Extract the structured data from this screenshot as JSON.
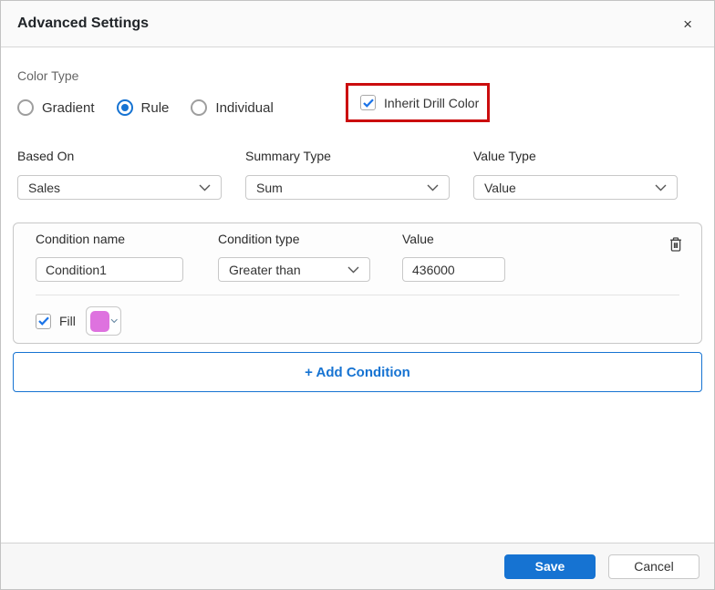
{
  "dialog": {
    "title": "Advanced Settings"
  },
  "icons": {
    "close": "×",
    "check": "✓",
    "chevron_down": "⌄",
    "trash": "trash-can",
    "color_swatch": "fill-color-swatch"
  },
  "color_type": {
    "label": "Color Type",
    "options": [
      {
        "label": "Gradient",
        "selected": false
      },
      {
        "label": "Rule",
        "selected": true
      },
      {
        "label": "Individual",
        "selected": false
      }
    ]
  },
  "inherit_drill_color": {
    "label": "Inherit Drill Color",
    "checked": true,
    "highlight_border_color": "#cb0d0e"
  },
  "selectors": [
    {
      "label": "Based On",
      "value": "Sales"
    },
    {
      "label": "Summary Type",
      "value": "Sum"
    },
    {
      "label": "Value Type",
      "value": "Value"
    }
  ],
  "condition": {
    "name_label": "Condition name",
    "name_value": "Condition1",
    "type_label": "Condition type",
    "type_value": "Greater than",
    "value_label": "Value",
    "value_value": "436000",
    "fill_label": "Fill",
    "fill_checked": true,
    "fill_color": "#de72df"
  },
  "add_condition_label": "+ Add Condition",
  "footer": {
    "save_label": "Save",
    "cancel_label": "Cancel"
  },
  "colors": {
    "accent_blue": "#1673d2",
    "check_blue": "#1a73e8",
    "highlight_red": "#cb0d0e",
    "fill_swatch": "#de72df",
    "header_bg": "#fafafa",
    "footer_bg": "#f7f7f7"
  }
}
